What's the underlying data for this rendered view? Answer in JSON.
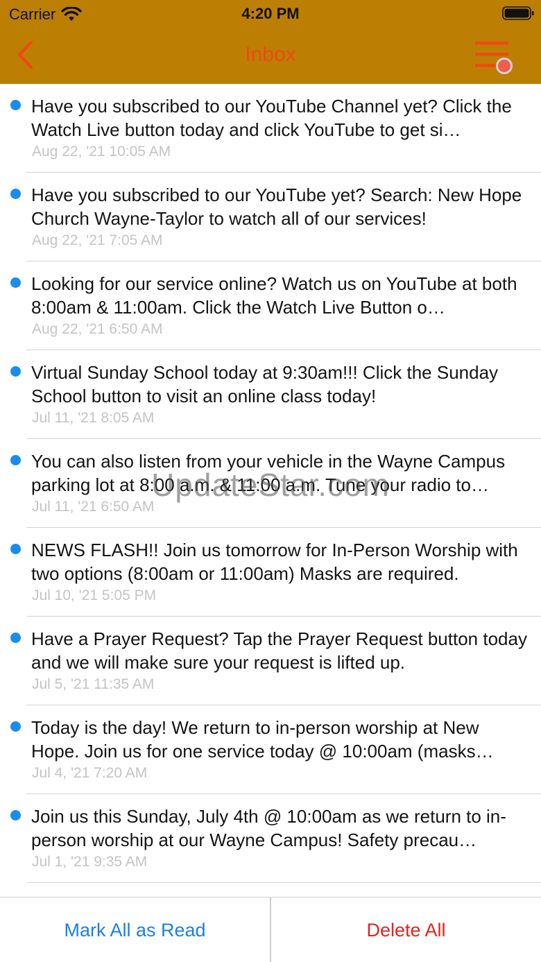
{
  "status_bar": {
    "carrier": "Carrier",
    "time": "4:20 PM",
    "icons": [
      "wifi-icon",
      "battery-icon"
    ]
  },
  "nav": {
    "title": "Inbox",
    "back_icon": "chevron-left-icon",
    "menu_icon": "hamburger-menu-icon",
    "colors": {
      "bar": "#bc7f04",
      "accent": "#f04a14",
      "badge": "#f25c4e"
    }
  },
  "messages": [
    {
      "text": "Have you subscribed to our YouTube Channel yet? Click the Watch Live button today and click YouTube to get si…",
      "date": "Aug 22, '21 10:05 AM",
      "unread": true
    },
    {
      "text": "Have you subscribed to our YouTube yet? Search: New Hope Church Wayne-Taylor to watch all of our services!",
      "date": "Aug 22, '21 7:05 AM",
      "unread": true
    },
    {
      "text": "Looking for our service online? Watch us on YouTube at both 8:00am & 11:00am. Click the Watch Live Button o…",
      "date": "Aug 22, '21 6:50 AM",
      "unread": true
    },
    {
      "text": "Virtual Sunday School today at 9:30am!!! Click the Sunday School button to visit an online class today!",
      "date": "Jul 11, '21 8:05 AM",
      "unread": true
    },
    {
      "text": "You can also listen from your vehicle in the Wayne Campus parking lot at 8:00 a.m. & 11:00 a.m.  Tune your radio to…",
      "date": "Jul 11, '21 6:50 AM",
      "unread": true
    },
    {
      "text": "NEWS FLASH!! Join us tomorrow for In-Person Worship with two options (8:00am or 11:00am) Masks are required.",
      "date": "Jul 10, '21 5:05 PM",
      "unread": true
    },
    {
      "text": "Have a Prayer Request? Tap the Prayer Request button today and we will make sure your request is lifted up.",
      "date": "Jul 5, '21 11:35 AM",
      "unread": true
    },
    {
      "text": "Today is the day! We return to in-person worship at New Hope. Join us for one service today @ 10:00am (masks…",
      "date": "Jul 4, '21 7:20 AM",
      "unread": true
    },
    {
      "text": "Join us this Sunday, July 4th @ 10:00am as we return to in-person worship at our Wayne Campus! Safety precau…",
      "date": "Jul 1, '21 9:35 AM",
      "unread": true
    }
  ],
  "toolbar": {
    "mark_all_label": "Mark All as Read",
    "delete_all_label": "Delete All"
  },
  "watermark": "UpdateStar.com"
}
